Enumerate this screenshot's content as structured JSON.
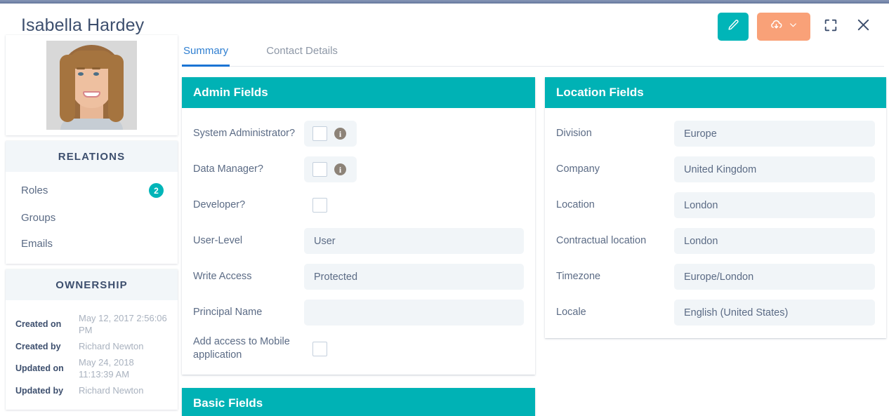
{
  "header": {
    "title": "Isabella Hardey",
    "actions": [
      {
        "name": "edit-button",
        "icon": "pencil-icon",
        "color": "#00b5b8"
      },
      {
        "name": "export-button",
        "icon": "cloud-download-icon",
        "color": "#f9a178",
        "chevron": "chevron-down-icon"
      },
      {
        "name": "fullscreen-button",
        "icon": "fullscreen-icon",
        "color": "#3d4f6e"
      },
      {
        "name": "close-button",
        "icon": "close-icon",
        "color": "#3d4f6e"
      }
    ]
  },
  "sidebar": {
    "avatar_alt": "Isabella Hardey portrait photo",
    "relations": {
      "title": "RELATIONS",
      "items": [
        {
          "label": "Roles",
          "badge": "2"
        },
        {
          "label": "Groups",
          "badge": ""
        },
        {
          "label": "Emails",
          "badge": ""
        }
      ]
    },
    "ownership": {
      "title": "OWNERSHIP",
      "rows": [
        {
          "key": "Created on",
          "value": "May 12, 2017 2:56:06 PM"
        },
        {
          "key": "Created by",
          "value": "Richard Newton"
        },
        {
          "key": "Updated on",
          "value": "May 24, 2018 11:13:39 AM"
        },
        {
          "key": "Updated by",
          "value": "Richard Newton"
        }
      ]
    }
  },
  "tabs": [
    {
      "label": "Summary",
      "active": true
    },
    {
      "label": "Contact Details",
      "active": false
    }
  ],
  "admin_fields": {
    "title": "Admin Fields",
    "rows": [
      {
        "label": "System Administrator?",
        "type": "checkbox",
        "checked": false,
        "info": true
      },
      {
        "label": "Data Manager?",
        "type": "checkbox",
        "checked": false,
        "info": true
      },
      {
        "label": "Developer?",
        "type": "checkbox-plain",
        "checked": false,
        "info": false
      },
      {
        "label": "User-Level",
        "type": "text",
        "value": "User"
      },
      {
        "label": "Write Access",
        "type": "text",
        "value": "Protected"
      },
      {
        "label": "Principal Name",
        "type": "text",
        "value": ""
      },
      {
        "label": "Add access to Mobile application",
        "type": "checkbox-plain",
        "checked": false,
        "info": false
      }
    ]
  },
  "location_fields": {
    "title": "Location Fields",
    "rows": [
      {
        "label": "Division",
        "value": "Europe"
      },
      {
        "label": "Company",
        "value": "United Kingdom"
      },
      {
        "label": "Location",
        "value": "London"
      },
      {
        "label": "Contractual location",
        "value": "London"
      },
      {
        "label": "Timezone",
        "value": "Europe/London"
      },
      {
        "label": "Locale",
        "value": "English (United States)"
      }
    ]
  },
  "basic_fields": {
    "title": "Basic Fields"
  },
  "colors": {
    "teal": "#00b2b5",
    "orange": "#f9a178",
    "navy": "#3d4f6e",
    "tab_active": "#1b74d4",
    "field_bg": "#f1f5f8"
  }
}
